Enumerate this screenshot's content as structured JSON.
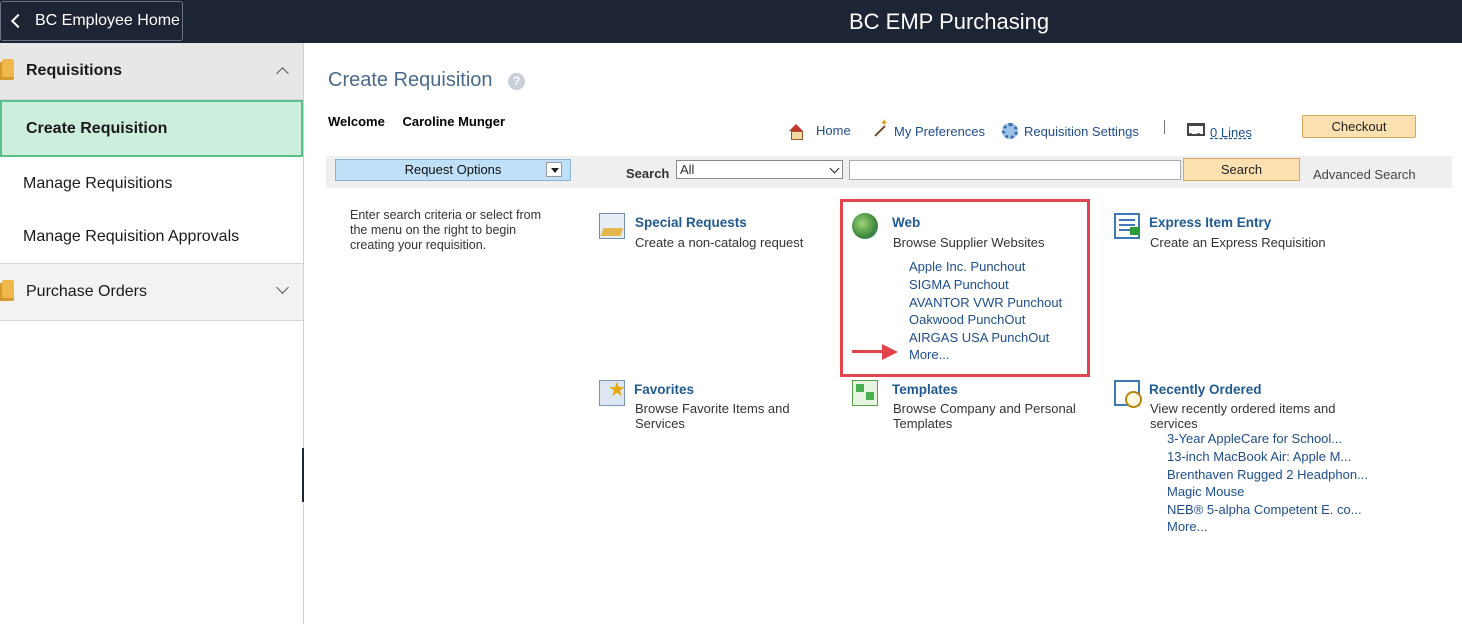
{
  "banner": {
    "back_label": "BC Employee Home",
    "title": "BC EMP Purchasing"
  },
  "sidebar": {
    "groups": [
      {
        "label": "Requisitions",
        "expanded": true
      },
      {
        "label": "Purchase Orders",
        "expanded": false
      }
    ],
    "items": [
      {
        "label": "Create Requisition",
        "active": true
      },
      {
        "label": "Manage Requisitions"
      },
      {
        "label": "Manage Requisition Approvals"
      }
    ]
  },
  "page": {
    "title": "Create Requisition",
    "help": "?",
    "welcome_label": "Welcome",
    "user_name": "Caroline Munger"
  },
  "toplinks": {
    "home": "Home",
    "preferences": "My Preferences",
    "settings": "Requisition Settings",
    "lines": "0 Lines",
    "checkout": "Checkout"
  },
  "search": {
    "request_options": "Request Options",
    "label": "Search",
    "scope": "All",
    "query": "",
    "button": "Search",
    "advanced": "Advanced Search"
  },
  "instructions": "Enter search criteria or select from the menu on the right to begin creating your requisition.",
  "tiles": {
    "special": {
      "title": "Special Requests",
      "desc": "Create a non-catalog request"
    },
    "web": {
      "title": "Web",
      "desc": "Browse Supplier Websites",
      "links": [
        "Apple Inc. Punchout",
        "SIGMA Punchout",
        "AVANTOR VWR Punchout",
        "Oakwood PunchOut",
        "AIRGAS USA PunchOut",
        "More..."
      ]
    },
    "express": {
      "title": "Express Item Entry",
      "desc": "Create an Express Requisition"
    },
    "favorites": {
      "title": "Favorites",
      "desc": "Browse Favorite Items and Services"
    },
    "templates": {
      "title": "Templates",
      "desc": "Browse Company and Personal Templates"
    },
    "recent": {
      "title": "Recently Ordered",
      "desc": "View recently ordered items and services",
      "links": [
        "3-Year AppleCare for School...",
        "13-inch MacBook Air: Apple M...",
        "Brenthaven Rugged 2 Headphon...",
        "Magic Mouse",
        "NEB® 5-alpha Competent E. co...",
        "More..."
      ]
    }
  },
  "annotation_color": "#e1444c"
}
